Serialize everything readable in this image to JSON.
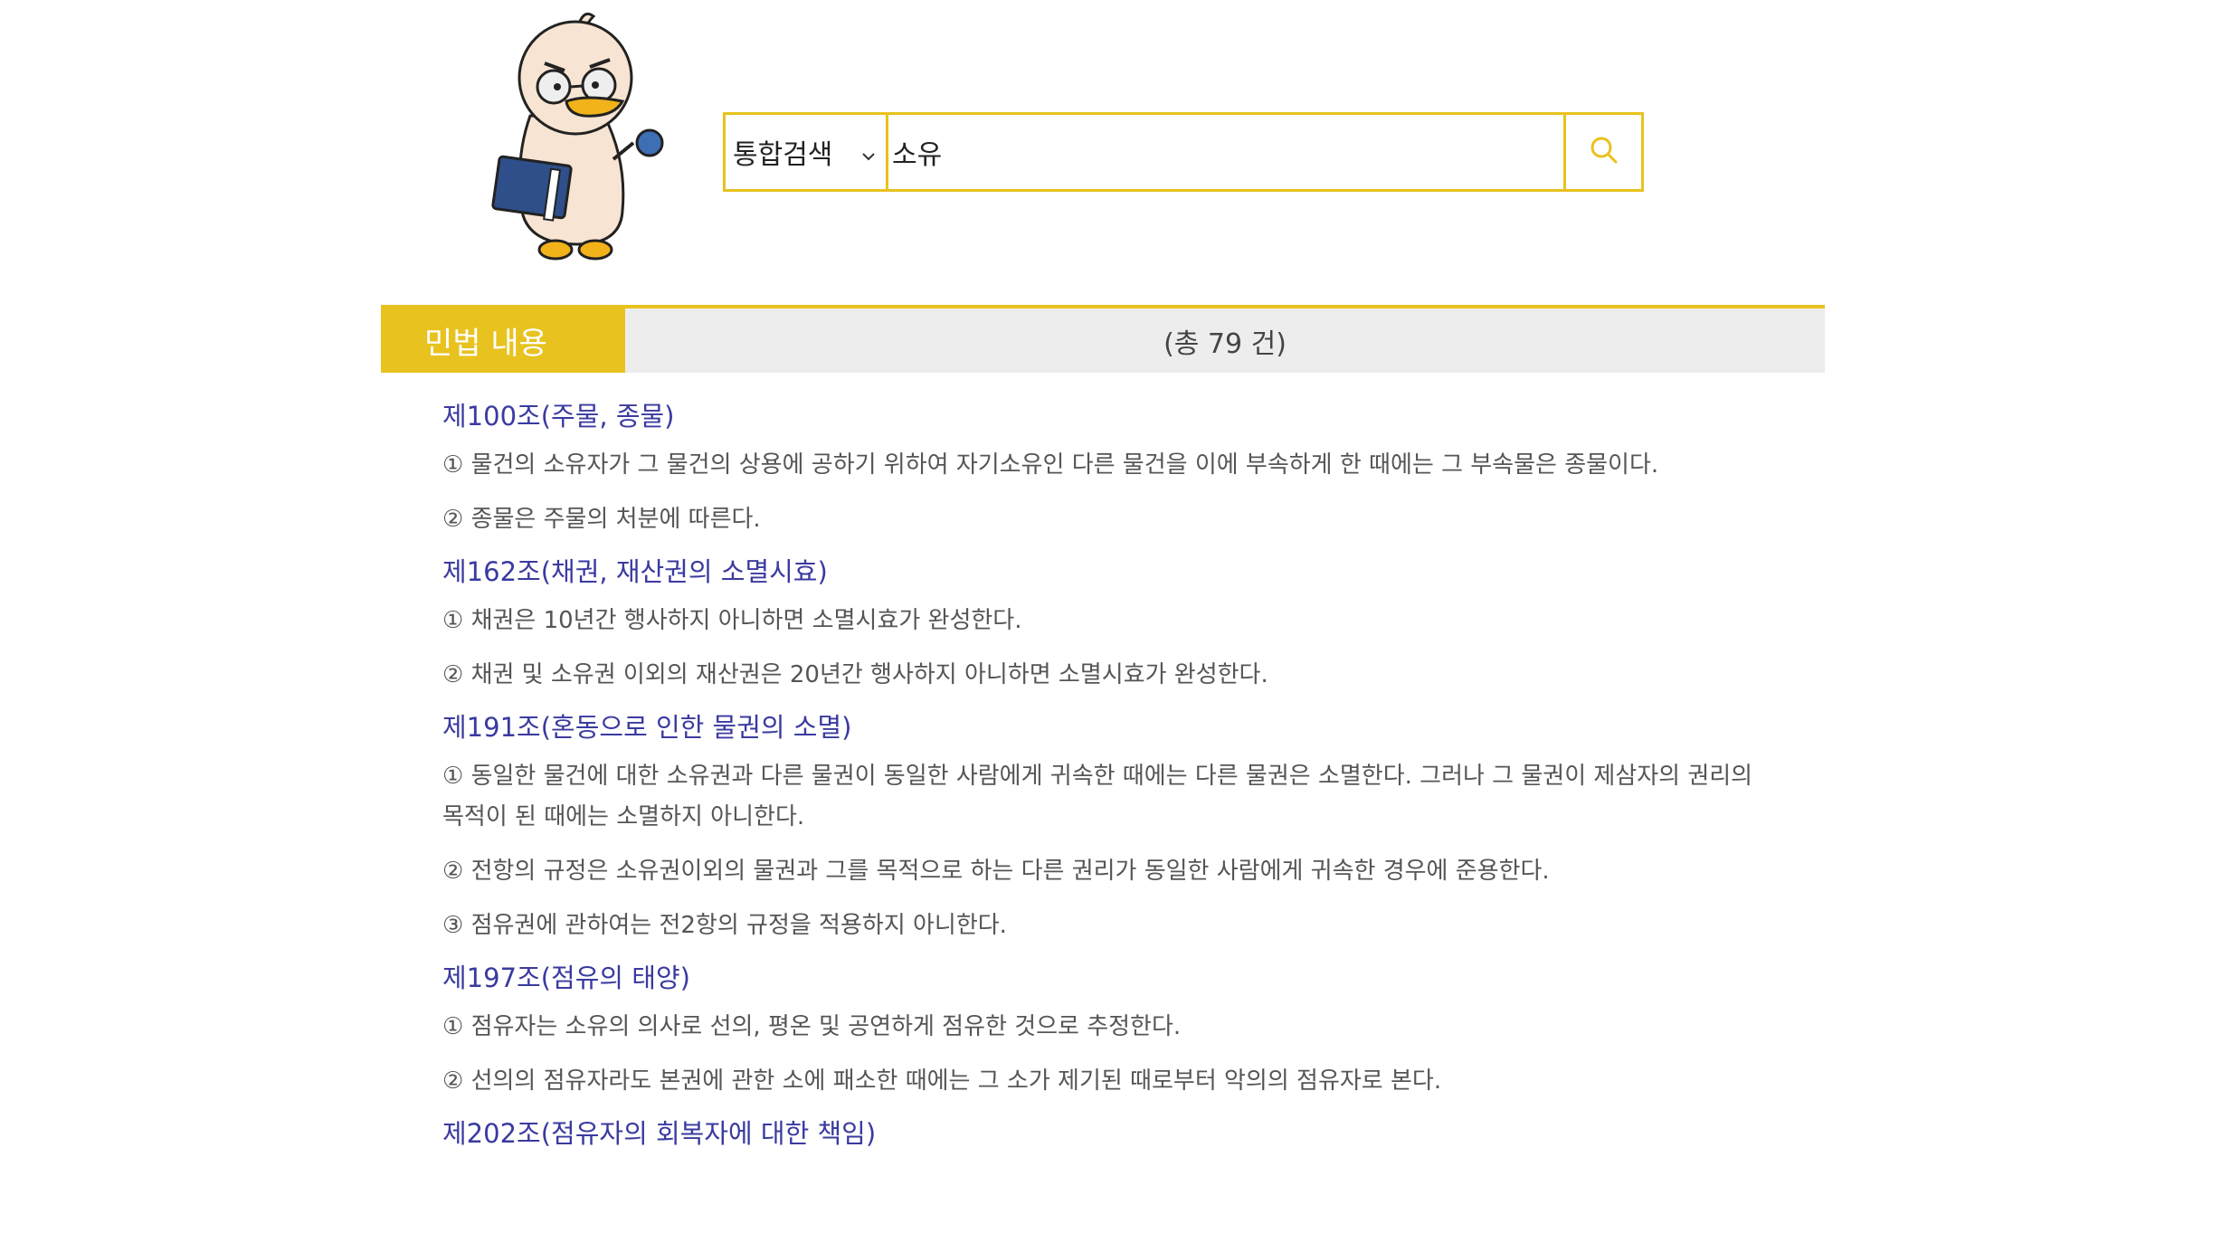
{
  "search": {
    "category": "통합검색",
    "query": "소유"
  },
  "section": {
    "title": "민법 내용",
    "count": "(총 79 건)"
  },
  "articles": [
    {
      "title": "제100조(주물, 종물)",
      "paragraphs": [
        "① 물건의 소유자가 그 물건의 상용에 공하기 위하여 자기소유인 다른 물건을 이에 부속하게 한 때에는 그 부속물은 종물이다.",
        "② 종물은 주물의 처분에 따른다."
      ]
    },
    {
      "title": "제162조(채권, 재산권의 소멸시효)",
      "paragraphs": [
        "① 채권은 10년간 행사하지 아니하면 소멸시효가 완성한다.",
        "② 채권 및 소유권 이외의 재산권은 20년간 행사하지 아니하면 소멸시효가 완성한다."
      ]
    },
    {
      "title": "제191조(혼동으로 인한 물권의 소멸)",
      "paragraphs": [
        "① 동일한 물건에 대한 소유권과 다른 물권이 동일한 사람에게 귀속한 때에는 다른 물권은 소멸한다. 그러나 그 물권이 제삼자의 권리의 목적이 된 때에는 소멸하지 아니한다.",
        "② 전항의 규정은 소유권이외의 물권과 그를 목적으로 하는 다른 권리가 동일한 사람에게 귀속한 경우에 준용한다.",
        "③ 점유권에 관하여는 전2항의 규정을 적용하지 아니한다."
      ]
    },
    {
      "title": "제197조(점유의 태양)",
      "paragraphs": [
        "① 점유자는 소유의 의사로 선의, 평온 및 공연하게 점유한 것으로 추정한다.",
        "② 선의의 점유자라도 본권에 관한 소에 패소한 때에는 그 소가 제기된 때로부터 악의의 점유자로 본다."
      ]
    },
    {
      "title": "제202조(점유자의 회복자에 대한 책임)",
      "paragraphs": []
    }
  ]
}
